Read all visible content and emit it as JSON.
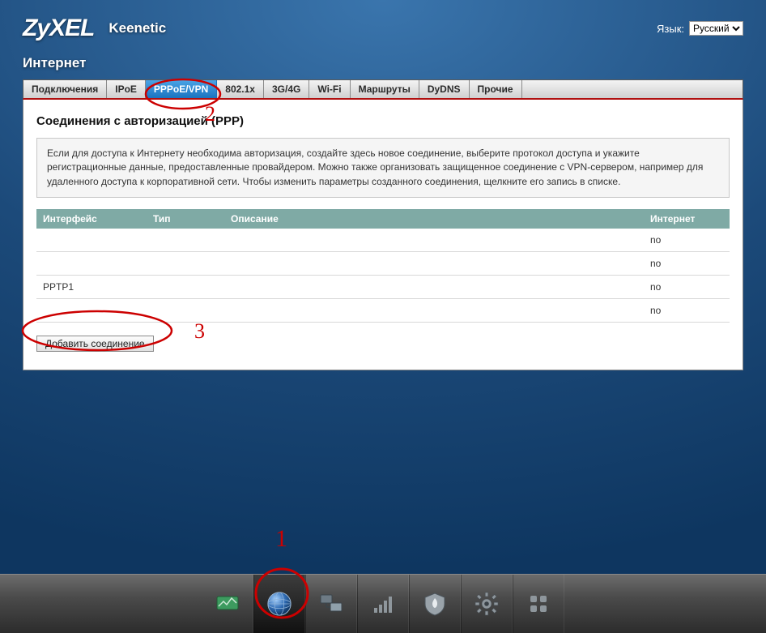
{
  "header": {
    "logo": "ZyXEL",
    "product": "Keenetic",
    "lang_label": "Язык:",
    "lang_value": "Русский"
  },
  "section_title": "Интернет",
  "tabs": [
    {
      "label": "Подключения"
    },
    {
      "label": "IPoE"
    },
    {
      "label": "PPPoE/VPN",
      "active": true
    },
    {
      "label": "802.1x"
    },
    {
      "label": "3G/4G"
    },
    {
      "label": "Wi-Fi"
    },
    {
      "label": "Маршруты"
    },
    {
      "label": "DyDNS"
    },
    {
      "label": "Прочие"
    }
  ],
  "panel": {
    "heading": "Соединения с авторизацией (PPP)",
    "info": "Если для доступа к Интернету необходима авторизация, создайте здесь новое соединение, выберите протокол доступа и укажите регистрационные данные, предоставленные провайдером. Можно также организовать защищенное соединение с VPN-сервером, например для удаленного доступа к корпоративной сети. Чтобы изменить параметры созданного соединения, щелкните его запись в списке.",
    "columns": {
      "iface": "Интерфейс",
      "type": "Тип",
      "desc": "Описание",
      "internet": "Интернет"
    },
    "rows": [
      {
        "iface": "",
        "type": "",
        "desc": "",
        "internet": "no"
      },
      {
        "iface": "",
        "type": "",
        "desc": "",
        "internet": "no"
      },
      {
        "iface": "PPTP1",
        "type": "",
        "desc": "",
        "internet": "no"
      },
      {
        "iface": "",
        "type": "",
        "desc": "",
        "internet": "no"
      }
    ],
    "add_button": "Добавить соединение"
  },
  "dock": {
    "items": [
      {
        "name": "monitor-icon"
      },
      {
        "name": "globe-icon",
        "active": true
      },
      {
        "name": "network-icon"
      },
      {
        "name": "wifi-icon"
      },
      {
        "name": "firewall-icon"
      },
      {
        "name": "settings-icon"
      },
      {
        "name": "apps-icon"
      }
    ]
  },
  "annotations": {
    "n1": "1",
    "n2": "2",
    "n3": "3"
  }
}
